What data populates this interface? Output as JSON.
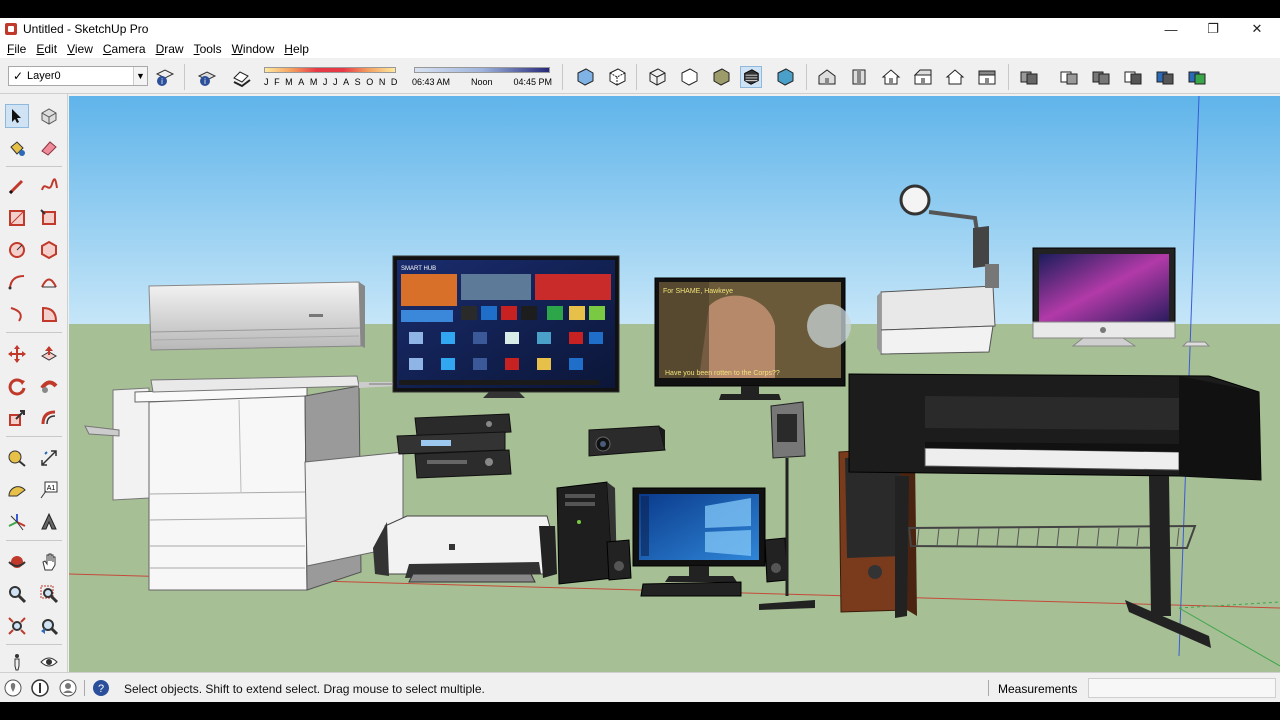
{
  "window": {
    "title": "Untitled - SketchUp Pro",
    "minimize": "—",
    "restore": "❐",
    "close": "✕"
  },
  "menu": [
    {
      "key": "F",
      "rest": "ile"
    },
    {
      "key": "E",
      "rest": "dit"
    },
    {
      "key": "V",
      "rest": "iew"
    },
    {
      "key": "C",
      "rest": "amera"
    },
    {
      "key": "D",
      "rest": "raw"
    },
    {
      "key": "T",
      "rest": "ools"
    },
    {
      "key": "W",
      "rest": "indow"
    },
    {
      "key": "H",
      "rest": "elp"
    }
  ],
  "toolbar": {
    "layer_check": "✓",
    "layer_name": "Layer0",
    "months": [
      "J",
      "F",
      "M",
      "A",
      "M",
      "J",
      "J",
      "A",
      "S",
      "O",
      "N",
      "D"
    ],
    "time_start": "06:43 AM",
    "time_mid": "Noon",
    "time_end": "04:45 PM"
  },
  "statusbar": {
    "message": "Select objects. Shift to extend select. Drag mouse to select multiple.",
    "measurements_label": "Measurements",
    "measurements_value": ""
  },
  "scene": {
    "smart_hub_label": "SMART HUB",
    "tv_subtitle_top": "For SHAME, Hawkeye",
    "tv_subtitle_bottom": "Have you been rotten to the Corps??",
    "colors": {
      "sky": "#8cc6ee",
      "ground": "#a7bf95",
      "axis_red": "#c44a3a",
      "axis_green": "#3da64a",
      "axis_blue": "#3b5bd6"
    }
  }
}
